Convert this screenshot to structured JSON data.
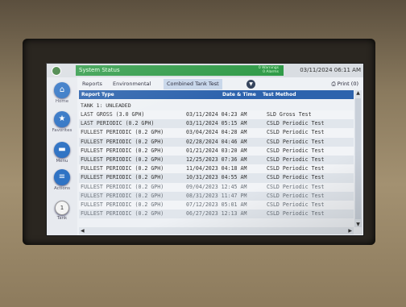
{
  "header": {
    "status_title": "System Status",
    "warnings": "0 Warnings",
    "alarms": "0 Alarms",
    "datetime": "03/11/2024 06:11 AM"
  },
  "sidebar": {
    "items": [
      {
        "label": "Home",
        "icon": "home-icon",
        "glyph": "⌂"
      },
      {
        "label": "Favorites",
        "icon": "star-icon",
        "glyph": "★"
      },
      {
        "label": "Menu",
        "icon": "menu-icon",
        "glyph": "▬"
      },
      {
        "label": "Actions",
        "icon": "actions-icon",
        "glyph": "≡"
      },
      {
        "label": "Tank",
        "icon": "tank-number-icon",
        "glyph": "1"
      }
    ]
  },
  "tabs": {
    "reports": "Reports",
    "environmental": "Environmental",
    "combined": "Combined Tank Test",
    "print": "Print (0)"
  },
  "table": {
    "headers": {
      "type": "Report Type",
      "datetime": "Date & Time",
      "method": "Test Method"
    },
    "tank_label": "TANK 1: UNLEADED",
    "rows": [
      {
        "type": "LAST GROSS (3.0 GPH)",
        "datetime": "03/11/2024 04:23 AM",
        "method": "SLD Gross Test"
      },
      {
        "type": "LAST PERIODIC (0.2 GPH)",
        "datetime": "03/11/2024 05:15 AM",
        "method": "CSLD Periodic Test"
      },
      {
        "type": "FULLEST PERIODIC (0.2 GPH)",
        "datetime": "03/04/2024 04:28 AM",
        "method": "CSLD Periodic Test"
      },
      {
        "type": "FULLEST PERIODIC (0.2 GPH)",
        "datetime": "02/28/2024 04:46 AM",
        "method": "CSLD Periodic Test"
      },
      {
        "type": "FULLEST PERIODIC (0.2 GPH)",
        "datetime": "01/21/2024 03:20 AM",
        "method": "CSLD Periodic Test"
      },
      {
        "type": "FULLEST PERIODIC (0.2 GPH)",
        "datetime": "12/25/2023 07:36 AM",
        "method": "CSLD Periodic Test"
      },
      {
        "type": "FULLEST PERIODIC (0.2 GPH)",
        "datetime": "11/04/2023 04:18 AM",
        "method": "CSLD Periodic Test"
      },
      {
        "type": "FULLEST PERIODIC (0.2 GPH)",
        "datetime": "10/31/2023 04:55 AM",
        "method": "CSLD Periodic Test"
      },
      {
        "type": "FULLEST PERIODIC (0.2 GPH)",
        "datetime": "09/04/2023 12:45 AM",
        "method": "CSLD Periodic Test"
      },
      {
        "type": "FULLEST PERIODIC (0.2 GPH)",
        "datetime": "08/31/2023 11:47 PM",
        "method": "CSLD Periodic Test"
      },
      {
        "type": "FULLEST PERIODIC (0.2 GPH)",
        "datetime": "07/12/2023 05:01 AM",
        "method": "CSLD Periodic Test"
      },
      {
        "type": "FULLEST PERIODIC (0.2 GPH)",
        "datetime": "06/27/2023 12:13 AM",
        "method": "CSLD Periodic Test"
      }
    ]
  },
  "colors": {
    "status_green": "#2f9a47",
    "header_blue": "#2d63ad",
    "nav_blue": "#2f73c4"
  }
}
